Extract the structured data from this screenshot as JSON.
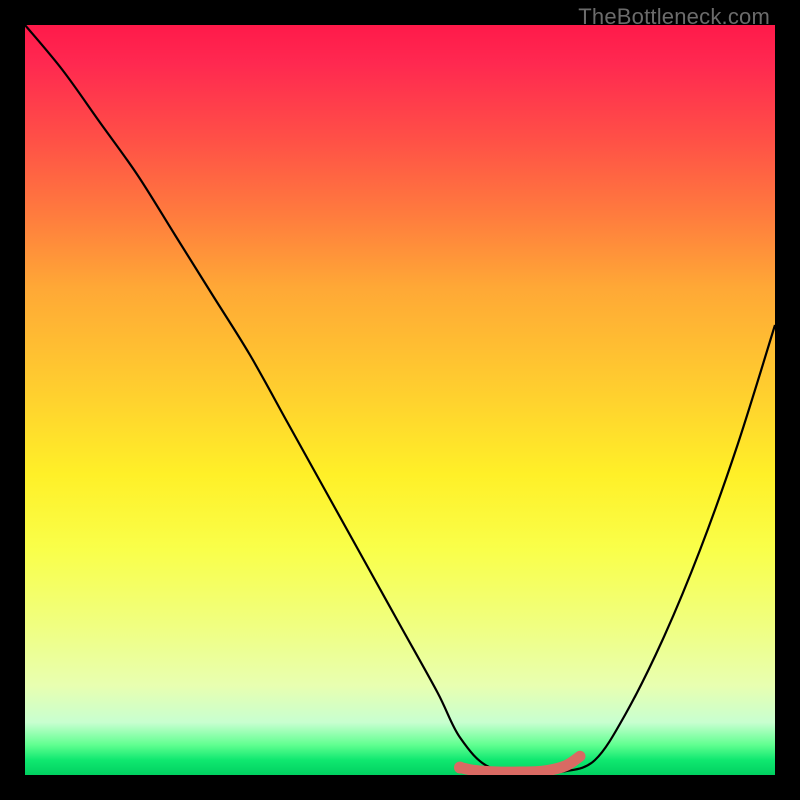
{
  "watermark": "TheBottleneck.com",
  "chart_data": {
    "type": "line",
    "title": "",
    "xlabel": "",
    "ylabel": "",
    "xlim": [
      0,
      100
    ],
    "ylim": [
      0,
      100
    ],
    "series": [
      {
        "name": "bottleneck-curve",
        "x": [
          0,
          5,
          10,
          15,
          20,
          25,
          30,
          35,
          40,
          45,
          50,
          55,
          58,
          62,
          68,
          72,
          76,
          80,
          85,
          90,
          95,
          100
        ],
        "values": [
          100,
          94,
          87,
          80,
          72,
          64,
          56,
          47,
          38,
          29,
          20,
          11,
          5,
          1,
          0.5,
          0.5,
          2,
          8,
          18,
          30,
          44,
          60
        ]
      },
      {
        "name": "sweet-spot-marker",
        "x": [
          58,
          60,
          63,
          66,
          69,
          72,
          74
        ],
        "values": [
          1,
          0.6,
          0.4,
          0.4,
          0.5,
          1.2,
          2.5
        ]
      }
    ],
    "gradient_stops": [
      {
        "pos": 0,
        "color": "#ff1a4a"
      },
      {
        "pos": 15,
        "color": "#ff4f47"
      },
      {
        "pos": 35,
        "color": "#ffa836"
      },
      {
        "pos": 50,
        "color": "#ffd22e"
      },
      {
        "pos": 70,
        "color": "#f9ff4a"
      },
      {
        "pos": 93,
        "color": "#c8ffd0"
      },
      {
        "pos": 100,
        "color": "#00d060"
      }
    ],
    "marker_color": "#d96a63",
    "curve_color": "#000000"
  }
}
